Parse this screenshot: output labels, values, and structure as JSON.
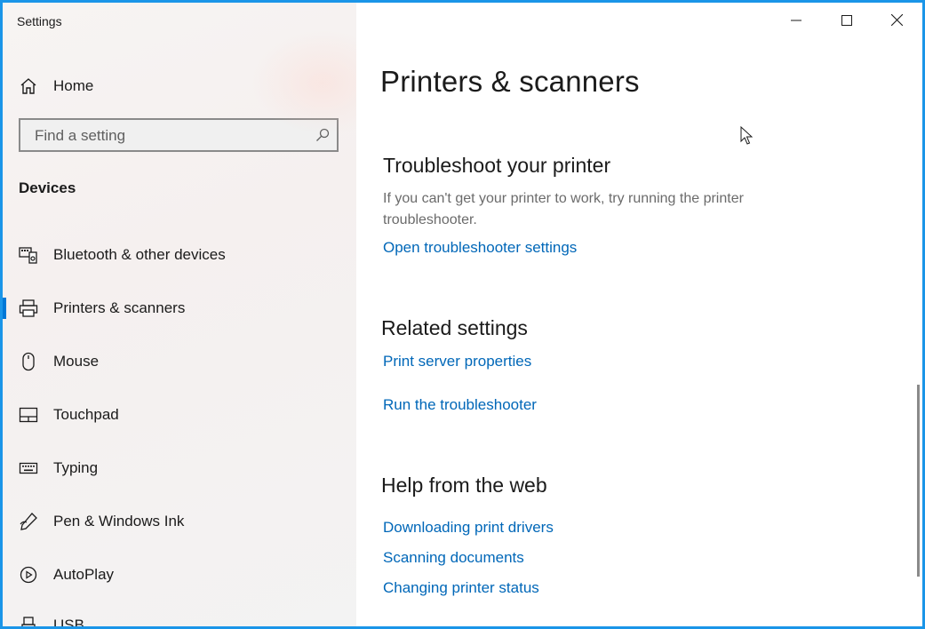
{
  "window": {
    "title": "Settings",
    "accent_color": "#1a95e8"
  },
  "sidebar": {
    "home_label": "Home",
    "search_placeholder": "Find a setting",
    "section_heading": "Devices",
    "items": [
      {
        "label": "Bluetooth & other devices",
        "icon": "bluetooth-devices-icon",
        "selected": false
      },
      {
        "label": "Printers & scanners",
        "icon": "printer-icon",
        "selected": true
      },
      {
        "label": "Mouse",
        "icon": "mouse-icon",
        "selected": false
      },
      {
        "label": "Touchpad",
        "icon": "touchpad-icon",
        "selected": false
      },
      {
        "label": "Typing",
        "icon": "keyboard-icon",
        "selected": false
      },
      {
        "label": "Pen & Windows Ink",
        "icon": "pen-icon",
        "selected": false
      },
      {
        "label": "AutoPlay",
        "icon": "autoplay-icon",
        "selected": false
      },
      {
        "label": "USB",
        "icon": "usb-icon",
        "selected": false
      }
    ]
  },
  "main": {
    "page_title": "Printers & scanners",
    "troubleshoot": {
      "heading": "Troubleshoot your printer",
      "description": "If you can't get your printer to work, try running the printer troubleshooter.",
      "link": "Open troubleshooter settings"
    },
    "related": {
      "heading": "Related settings",
      "links": [
        "Print server properties",
        "Run the troubleshooter"
      ]
    },
    "help": {
      "heading": "Help from the web",
      "links": [
        "Downloading print drivers",
        "Scanning documents",
        "Changing printer status"
      ]
    },
    "link_color": "#0067b8"
  },
  "window_controls": {
    "minimize": "minimize-icon",
    "maximize": "maximize-icon",
    "close": "close-icon"
  }
}
